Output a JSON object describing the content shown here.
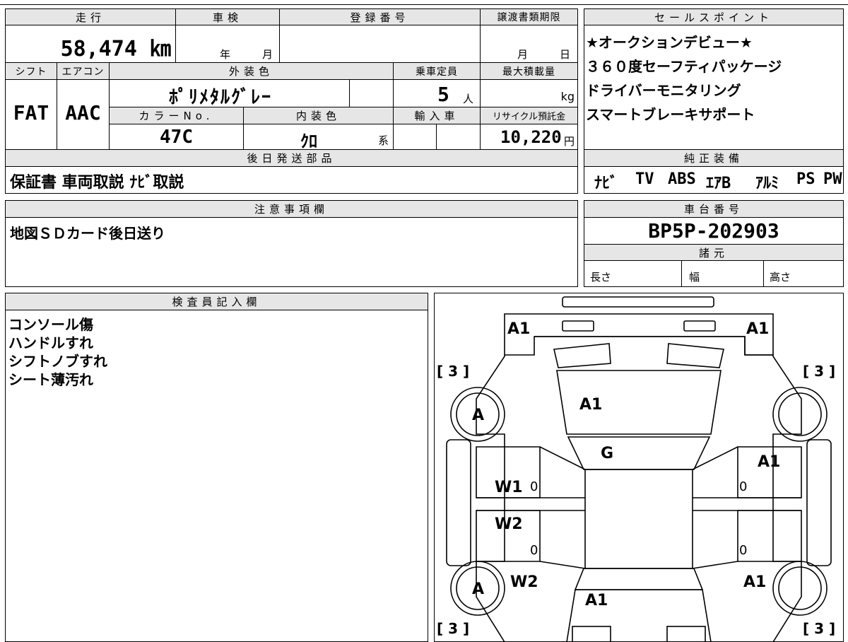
{
  "sheet": {
    "mileage": {
      "header": "走行",
      "value": "58,474 ㎞"
    },
    "inspection": {
      "header": "車検",
      "year_unit": "年",
      "month_unit": "月"
    },
    "registration": {
      "header": "登録番号"
    },
    "transfer_deadline": {
      "header": "譲渡書類期限",
      "month_unit": "月",
      "day_unit": "日"
    },
    "shift": {
      "header": "シフト",
      "value": "FAT"
    },
    "aircon": {
      "header": "エアコン",
      "value": "AAC"
    },
    "exterior_color": {
      "header": "外装色",
      "value": "ﾎﾟﾘﾒﾀﾙｸﾞﾚｰ"
    },
    "capacity": {
      "header": "乗車定員",
      "value": "5",
      "unit": "人"
    },
    "max_load": {
      "header": "最大積載量",
      "unit": "kg"
    },
    "color_no": {
      "header": "カラーNo.",
      "value": "47C"
    },
    "interior_color": {
      "header": "内装色",
      "value": "ｸﾛ",
      "suffix": "系"
    },
    "import": {
      "header": "輸入車"
    },
    "recycle": {
      "header": "リサイクル預託金",
      "value": "10,220",
      "unit": "円"
    },
    "deferred_parts": {
      "header": "後日発送部品",
      "value": "保証書 車両取説 ﾅﾋﾞ取説"
    },
    "sales_points": {
      "header": "セールスポイント",
      "lines": [
        "★オークションデビュー★",
        "３６０度セーフティパッケージ",
        "ドライバーモニタリング",
        "スマートブレーキサポート"
      ]
    },
    "genuine_equipment": {
      "header": "純正装備",
      "items": [
        "ﾅﾋﾞ",
        "TV",
        "ABS",
        "ｴｱB",
        "ｱﾙﾐ",
        "PS",
        "PW"
      ]
    },
    "notes": {
      "header": "注意事項欄",
      "value": "地図ＳＤカード後日送り"
    },
    "chassis": {
      "header": "車台番号",
      "value": "BP5P-202903"
    },
    "specs": {
      "header": "諸元",
      "length_label": "長さ",
      "width_label": "幅",
      "height_label": "高さ"
    },
    "inspector": {
      "header": "検査員記入欄",
      "lines": [
        "コンソール傷",
        "ハンドルすれ",
        "シフトノブすれ",
        "シート薄汚れ"
      ]
    }
  },
  "diagram": {
    "labels": {
      "front_left_bumper": "A1",
      "front_right_bumper": "A1",
      "hood": "A1",
      "windshield": "G",
      "left_front_tire_mark": "A",
      "left_rear_tire_mark": "A",
      "left_front_door": "W1",
      "left_rear_door": "W2",
      "left_rear_fender": "W2",
      "right_front_door": "A1",
      "right_rear_fender": "A1",
      "trunk": "A1",
      "left_front_door_num": "0",
      "left_rear_door_num": "0",
      "right_front_door_num": "0",
      "right_rear_door_num": "0",
      "bracket_tl": "[ 3 ]",
      "bracket_tr": "[ 3 ]",
      "bracket_bl": "[ 3 ]",
      "bracket_br": "[ 3 ]"
    }
  }
}
